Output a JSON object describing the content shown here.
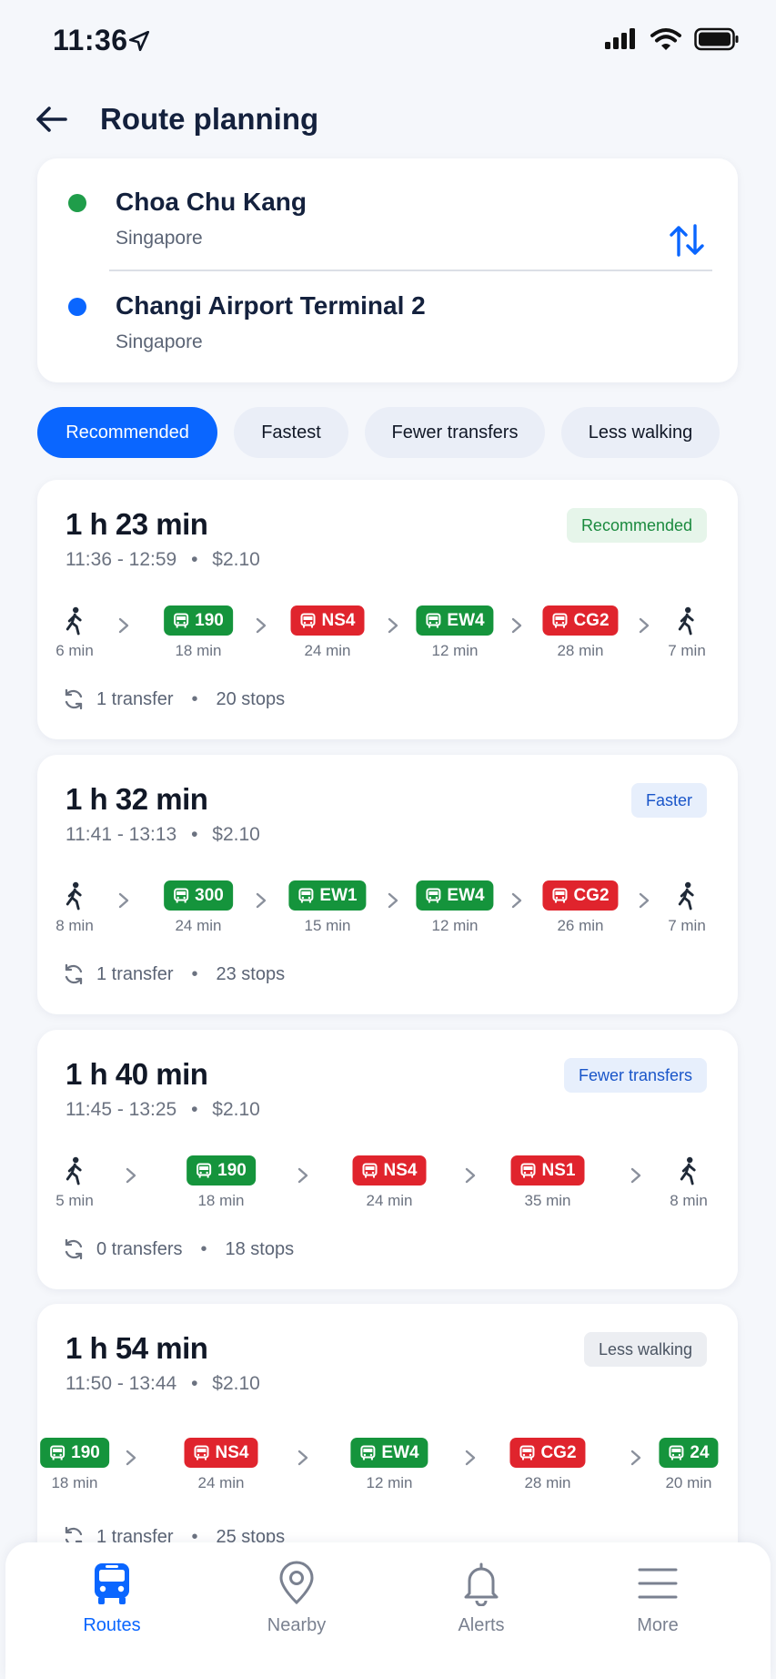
{
  "status_bar": {
    "time": "11:36"
  },
  "header": {
    "title": "Route planning"
  },
  "locations": {
    "origin": {
      "name": "Choa Chu Kang",
      "sub": "Singapore",
      "color": "#1f9d4a"
    },
    "destination": {
      "name": "Changi Airport Terminal 2",
      "sub": "Singapore",
      "color": "#0a66ff"
    }
  },
  "filters": [
    "Recommended",
    "Fastest",
    "Fewer transfers",
    "Less walking"
  ],
  "routes": [
    {
      "duration": "1 h 23 min",
      "time": "11:36 - 12:59",
      "price": "$2.10",
      "badge": "Recommended",
      "badge_style": "green",
      "segments": [
        {
          "kind": "walk",
          "min": "6 min"
        },
        {
          "kind": "bus",
          "label": "190",
          "color": "green",
          "min": "18 min"
        },
        {
          "kind": "train",
          "label": "NS4",
          "color": "red",
          "min": "24 min"
        },
        {
          "kind": "train",
          "label": "EW4",
          "color": "green",
          "min": "12 min"
        },
        {
          "kind": "train",
          "label": "CG2",
          "color": "red",
          "min": "28 min"
        },
        {
          "kind": "walk",
          "min": "7 min"
        }
      ],
      "transfers": "1 transfer",
      "stops": "20 stops"
    },
    {
      "duration": "1 h 32 min",
      "time": "11:41 - 13:13",
      "price": "$2.10",
      "badge": "Faster",
      "badge_style": "blue",
      "segments": [
        {
          "kind": "walk",
          "min": "8 min"
        },
        {
          "kind": "bus",
          "label": "300",
          "color": "green",
          "min": "24 min"
        },
        {
          "kind": "train",
          "label": "EW1",
          "color": "green",
          "min": "15 min"
        },
        {
          "kind": "train",
          "label": "EW4",
          "color": "green",
          "min": "12 min"
        },
        {
          "kind": "train",
          "label": "CG2",
          "color": "red",
          "min": "26 min"
        },
        {
          "kind": "walk",
          "min": "7 min"
        }
      ],
      "transfers": "1 transfer",
      "stops": "23 stops"
    },
    {
      "duration": "1 h 40 min",
      "time": "11:45 - 13:25",
      "price": "$2.10",
      "badge": "Fewer transfers",
      "badge_style": "blue",
      "segments": [
        {
          "kind": "walk",
          "min": "5 min"
        },
        {
          "kind": "bus",
          "label": "190",
          "color": "green",
          "min": "18 min"
        },
        {
          "kind": "train",
          "label": "NS4",
          "color": "red",
          "min": "24 min"
        },
        {
          "kind": "train",
          "label": "NS1",
          "color": "red",
          "min": "35 min"
        },
        {
          "kind": "walk",
          "min": "8 min"
        }
      ],
      "transfers": "0 transfers",
      "stops": "18 stops"
    },
    {
      "duration": "1 h 54 min",
      "time": "11:50 - 13:44",
      "price": "$2.10",
      "badge": "Less walking",
      "badge_style": "gray",
      "segments": [
        {
          "kind": "bus",
          "label": "190",
          "color": "green",
          "min": "18 min"
        },
        {
          "kind": "train",
          "label": "NS4",
          "color": "red",
          "min": "24 min"
        },
        {
          "kind": "train",
          "label": "EW4",
          "color": "green",
          "min": "12 min"
        },
        {
          "kind": "train",
          "label": "CG2",
          "color": "red",
          "min": "28 min"
        },
        {
          "kind": "bus",
          "label": "24",
          "color": "green",
          "min": "20 min"
        }
      ],
      "transfers": "1 transfer",
      "stops": "25 stops"
    }
  ],
  "tabs": [
    {
      "label": "Routes",
      "icon": "bus-icon",
      "active": true
    },
    {
      "label": "Nearby",
      "icon": "location-pin-icon",
      "active": false
    },
    {
      "label": "Alerts",
      "icon": "bell-icon",
      "active": false
    },
    {
      "label": "More",
      "icon": "menu-icon",
      "active": false
    }
  ],
  "colors": {
    "accent": "#0a66ff",
    "green": "#15943c",
    "red": "#e0242d"
  }
}
